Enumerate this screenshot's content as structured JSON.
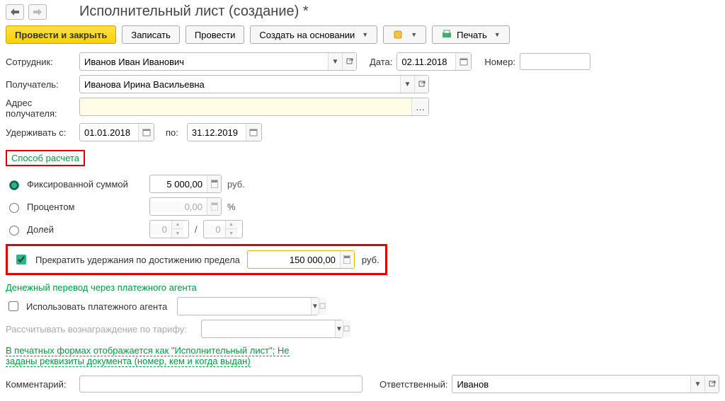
{
  "header": {
    "title": "Исполнительный лист (создание) *"
  },
  "toolbar": {
    "post_close": "Провести и закрыть",
    "save": "Записать",
    "post": "Провести",
    "create_based": "Создать на основании",
    "print": "Печать"
  },
  "form": {
    "employee_label": "Сотрудник:",
    "employee_value": "Иванов Иван Иванович",
    "date_label": "Дата:",
    "date_value": "02.11.2018",
    "number_label": "Номер:",
    "number_value": "",
    "recipient_label": "Получатель:",
    "recipient_value": "Иванова Ирина Васильевна",
    "addr_label1": "Адрес",
    "addr_label2": "получателя:",
    "hold_from_label": "Удерживать с:",
    "hold_from": "01.01.2018",
    "hold_to_label": "по:",
    "hold_to": "31.12.2019"
  },
  "calc": {
    "section": "Способ расчета",
    "fixed_label": "Фиксированной суммой",
    "fixed_value": "5 000,00",
    "fixed_unit": "руб.",
    "percent_label": "Процентом",
    "percent_value": "0,00",
    "fraction_label": "Долей",
    "fraction_num": "0",
    "fraction_den": "0",
    "limit_checkbox": "Прекратить удержания по достижению предела",
    "limit_value": "150 000,00",
    "limit_unit": "руб."
  },
  "agent": {
    "section": "Денежный перевод через платежного агента",
    "use_agent": "Использовать платежного агента",
    "tariff_label": "Рассчитывать вознаграждение по тарифу:",
    "link": "В печатных формах отображается как \"Исполнительный лист\"; Не заданы реквизиты документа (номер, кем и когда выдан)"
  },
  "footer": {
    "comment_label": "Комментарий:",
    "comment_value": "",
    "responsible_label": "Ответственный:",
    "responsible_value": "Иванов"
  }
}
